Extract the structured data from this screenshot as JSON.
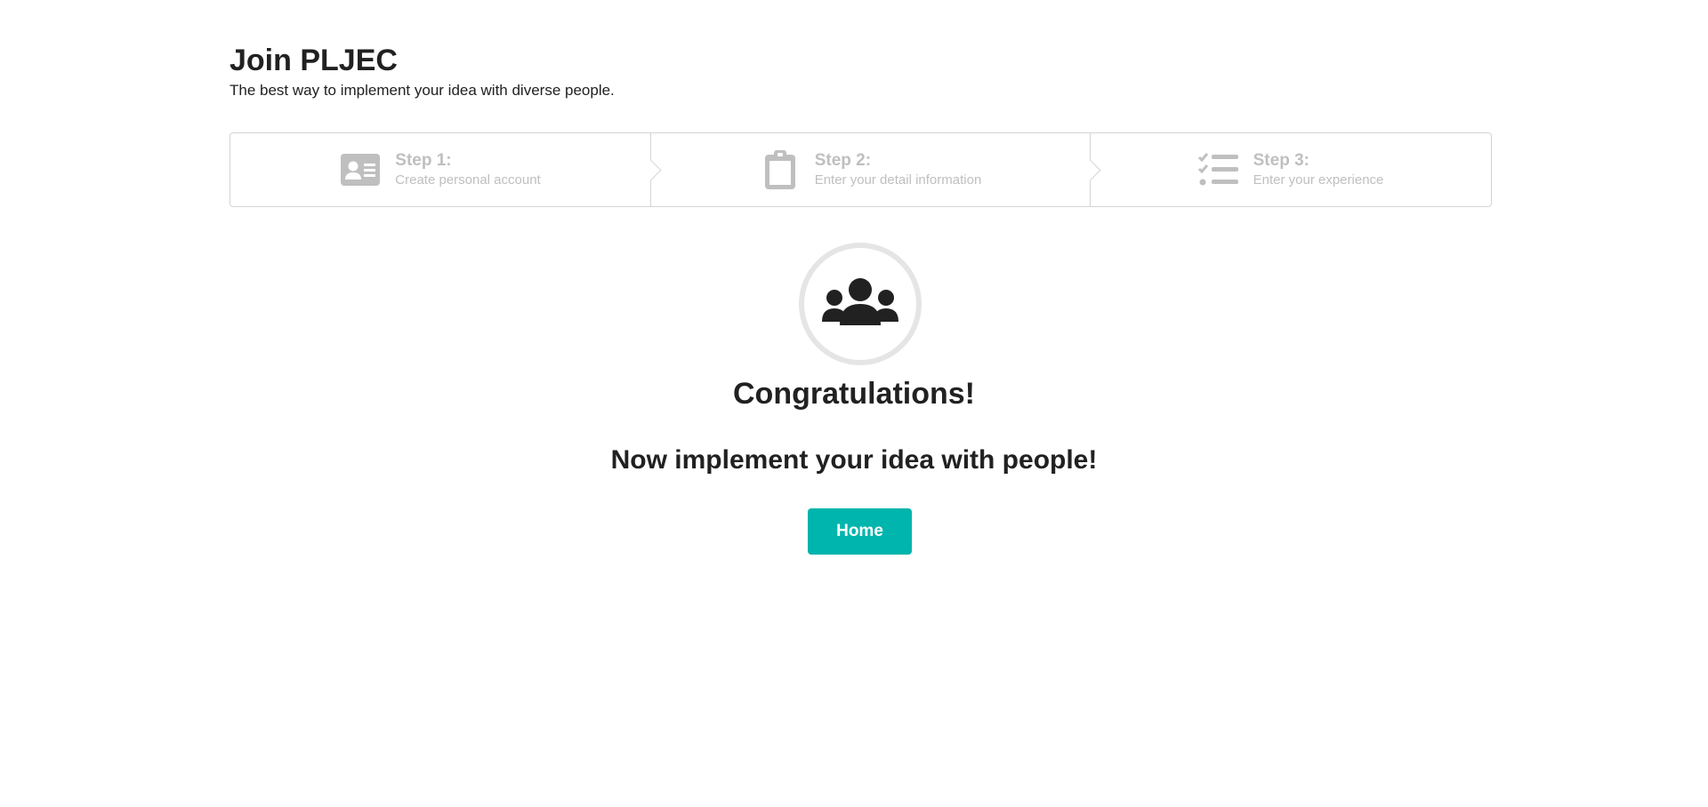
{
  "header": {
    "title": "Join PLJEC",
    "subtitle": "The best way to implement your idea with diverse people."
  },
  "steps": [
    {
      "title": "Step 1:",
      "description": "Create personal account",
      "icon": "id-card-icon"
    },
    {
      "title": "Step 2:",
      "description": "Enter your detail information",
      "icon": "clipboard-icon"
    },
    {
      "title": "Step 3:",
      "description": "Enter your experience",
      "icon": "checklist-icon"
    }
  ],
  "result": {
    "icon": "users-icon",
    "heading": "Congratulations!",
    "message": "Now implement your idea with people!",
    "home_label": "Home"
  },
  "colors": {
    "accent": "#00b5ad",
    "step_inactive": "#bfbfbf",
    "text": "#212121"
  }
}
